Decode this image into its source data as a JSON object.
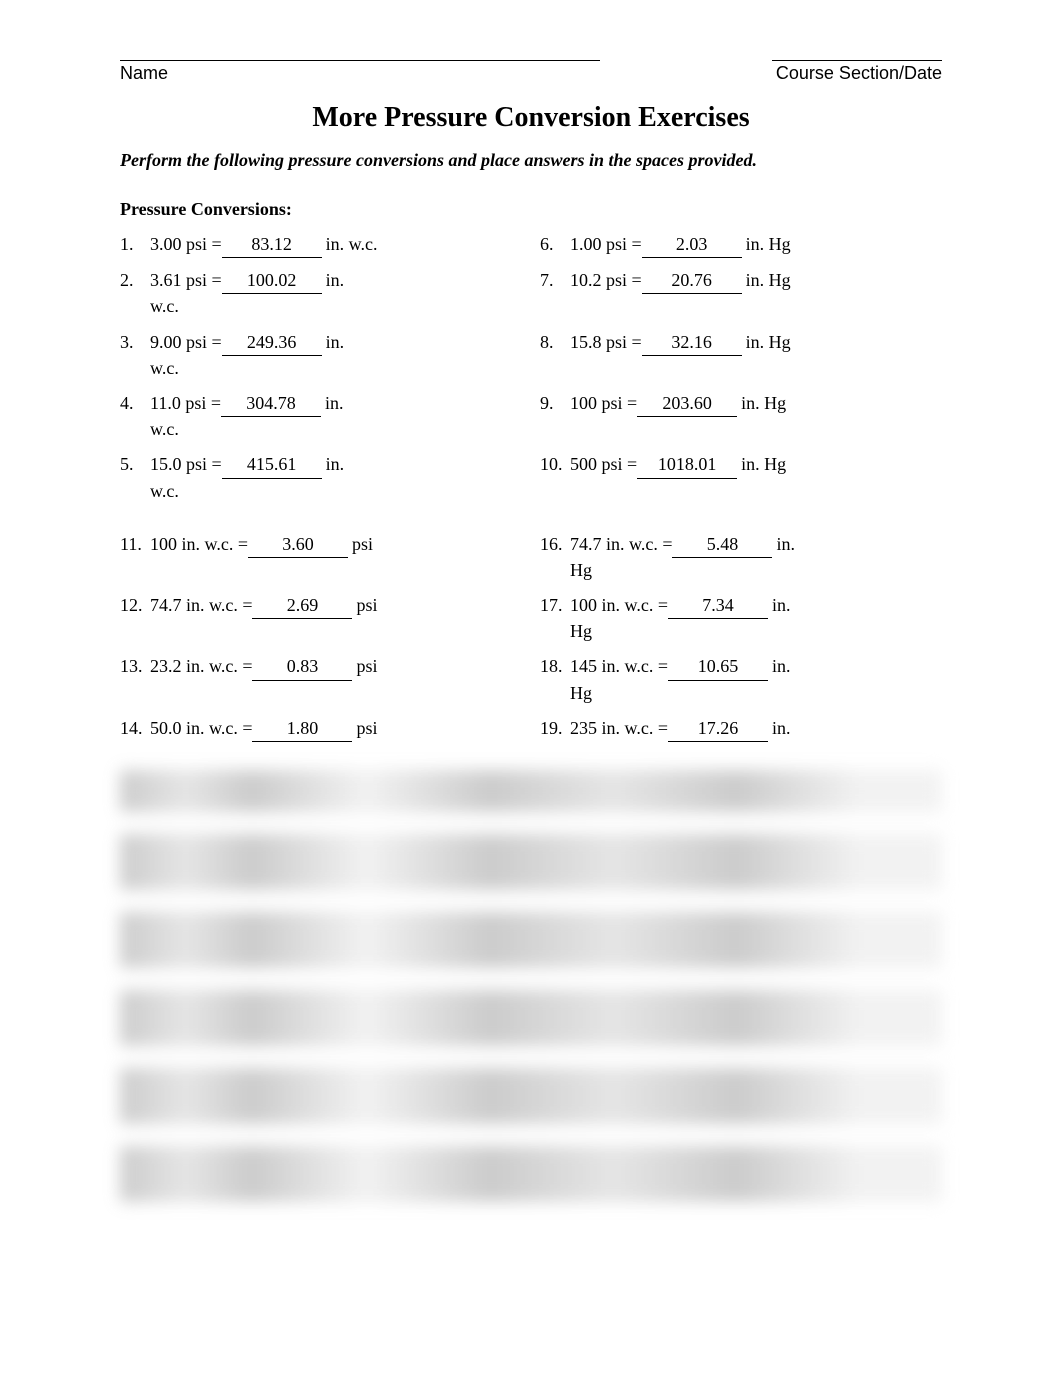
{
  "header": {
    "name_label": "Name",
    "course_label": "Course Section/Date"
  },
  "title": "More Pressure Conversion Exercises",
  "instructions": "Perform the following pressure conversions and place answers in the spaces provided.",
  "section_head": "Pressure Conversions:",
  "group1_left": [
    {
      "n": "1.",
      "lhs": "3.00 psi =",
      "val": "83.12",
      "unit": "in. w.c.",
      "wrap": false
    },
    {
      "n": "2.",
      "lhs": "3.61 psi =",
      "val": "100.02",
      "unit": "in.",
      "wrap": true,
      "wrap_text": "w.c."
    },
    {
      "n": "3.",
      "lhs": "9.00 psi =",
      "val": "249.36",
      "unit": "in.",
      "wrap": true,
      "wrap_text": "w.c."
    },
    {
      "n": "4.",
      "lhs": "11.0 psi =",
      "val": "304.78",
      "unit": "in.",
      "wrap": true,
      "wrap_text": "w.c."
    },
    {
      "n": "5.",
      "lhs": "15.0 psi =",
      "val": "415.61",
      "unit": "in.",
      "wrap": true,
      "wrap_text": "w.c."
    }
  ],
  "group1_right": [
    {
      "n": "6.",
      "lhs": "1.00 psi =",
      "val": "2.03",
      "unit": "in. Hg",
      "wrap": false
    },
    {
      "n": "7.",
      "lhs": "10.2 psi =",
      "val": "20.76",
      "unit": "in. Hg",
      "wrap": false
    },
    {
      "n": "8.",
      "lhs": "15.8 psi =",
      "val": "32.16",
      "unit": "in. Hg",
      "wrap": false
    },
    {
      "n": "9.",
      "lhs": "100 psi =",
      "val": "203.60",
      "unit": "in. Hg",
      "wrap": false
    },
    {
      "n": "10.",
      "lhs": "500 psi =",
      "val": "1018.01",
      "unit": "in. Hg",
      "wrap": false
    }
  ],
  "group2_left": [
    {
      "n": "11.",
      "lhs": "100 in. w.c. =",
      "val": "3.60",
      "unit": "psi",
      "wrap": false
    },
    {
      "n": "12.",
      "lhs": "74.7 in. w.c. =",
      "val": "2.69",
      "unit": "psi",
      "wrap": false
    },
    {
      "n": "13.",
      "lhs": "23.2 in. w.c. =",
      "val": "0.83",
      "unit": "psi",
      "wrap": false
    },
    {
      "n": "14.",
      "lhs": "50.0 in. w.c. =",
      "val": "1.80",
      "unit": "psi",
      "wrap": false
    }
  ],
  "group2_right": [
    {
      "n": "16.",
      "lhs": "74.7 in. w.c. =",
      "val": "5.48",
      "unit": "in.",
      "wrap": true,
      "wrap_text": "Hg"
    },
    {
      "n": "17.",
      "lhs": "100 in. w.c. =",
      "val": "7.34",
      "unit": "in.",
      "wrap": true,
      "wrap_text": "Hg"
    },
    {
      "n": "18.",
      "lhs": "145 in. w.c. =",
      "val": "10.65",
      "unit": "in.",
      "wrap": true,
      "wrap_text": "Hg"
    },
    {
      "n": "19.",
      "lhs": "235 in. w.c. =",
      "val": "17.26",
      "unit": "in.",
      "wrap": true,
      "wrap_text": ""
    }
  ]
}
